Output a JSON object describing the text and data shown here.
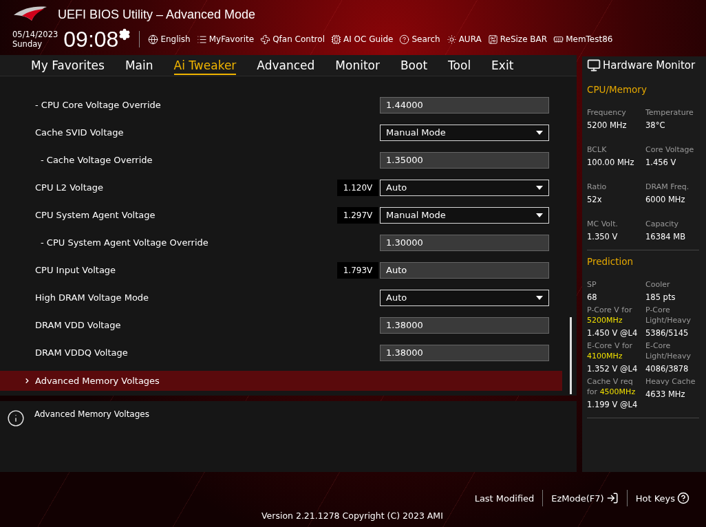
{
  "header": {
    "title": "UEFI BIOS Utility – Advanced Mode",
    "date": "05/14/2023",
    "day": "Sunday",
    "time": "09:08",
    "tools": [
      {
        "label": "English"
      },
      {
        "label": "MyFavorite"
      },
      {
        "label": "Qfan Control"
      },
      {
        "label": "AI OC Guide"
      },
      {
        "label": "Search"
      },
      {
        "label": "AURA"
      },
      {
        "label": "ReSize BAR"
      },
      {
        "label": "MemTest86"
      }
    ]
  },
  "tabs": [
    {
      "label": "My Favorites",
      "selected": false
    },
    {
      "label": "Main",
      "selected": false
    },
    {
      "label": "Ai Tweaker",
      "selected": true
    },
    {
      "label": "Advanced",
      "selected": false
    },
    {
      "label": "Monitor",
      "selected": false
    },
    {
      "label": "Boot",
      "selected": false
    },
    {
      "label": "Tool",
      "selected": false
    },
    {
      "label": "Exit",
      "selected": false
    }
  ],
  "settings": [
    {
      "label": "- CPU Core Voltage Override",
      "kind": "input",
      "value": "1.44000",
      "selected": false
    },
    {
      "label": "Cache SVID Voltage",
      "kind": "select",
      "value": "Manual Mode",
      "selected": false,
      "children": [
        {
          "label": "- Cache Voltage Override",
          "kind": "input",
          "value": "1.35000",
          "selected": false
        }
      ]
    },
    {
      "label": "CPU L2 Voltage",
      "kind": "select",
      "value": "Auto",
      "reading": "1.120V",
      "selected": false
    },
    {
      "label": "CPU System Agent Voltage",
      "kind": "select",
      "value": "Manual Mode",
      "reading": "1.297V",
      "selected": false,
      "children": [
        {
          "label": "- CPU System Agent Voltage Override",
          "kind": "input",
          "value": "1.30000",
          "selected": false
        }
      ]
    },
    {
      "label": "CPU Input Voltage",
      "kind": "input",
      "value": "Auto",
      "reading": "1.793V",
      "selected": false
    },
    {
      "label": "High DRAM Voltage Mode",
      "kind": "select",
      "value": "Auto",
      "selected": false
    },
    {
      "label": "DRAM VDD Voltage",
      "kind": "input",
      "value": "1.38000",
      "selected": false
    },
    {
      "label": "DRAM VDDQ Voltage",
      "kind": "input",
      "value": "1.38000",
      "selected": false
    },
    {
      "label": "Advanced Memory Voltages",
      "kind": "submenu",
      "selected": true
    }
  ],
  "help": {
    "text": "Advanced Memory Voltages"
  },
  "hardware_monitor": {
    "title": "Hardware Monitor",
    "sections": [
      {
        "title": "CPU/Memory",
        "items": [
          {
            "label": "Frequency",
            "value": "5200 MHz"
          },
          {
            "label": "Temperature",
            "value": "38°C"
          },
          {
            "label": "BCLK",
            "value": "100.00 MHz"
          },
          {
            "label": "Core Voltage",
            "value": "1.456 V"
          },
          {
            "label": "Ratio",
            "value": "52x"
          },
          {
            "label": "DRAM Freq.",
            "value": "6000 MHz"
          },
          {
            "label": "MC Volt.",
            "value": "1.350 V"
          },
          {
            "label": "Capacity",
            "value": "16384 MB"
          }
        ]
      },
      {
        "title": "Prediction",
        "items": [
          {
            "label": "SP",
            "value": "68"
          },
          {
            "label": "Cooler",
            "value": "185 pts"
          },
          {
            "label": "P-Core V for",
            "highlight": "5200MHz",
            "value": "1.450 V @L4"
          },
          {
            "label": "P-Core Light/Heavy",
            "value": "5386/5145"
          },
          {
            "label": "E-Core V for",
            "highlight": "4100MHz",
            "value": "1.352 V @L4"
          },
          {
            "label": "E-Core Light/Heavy",
            "value": "4086/3878"
          },
          {
            "label": "Cache V req for",
            "highlight": "4500MHz",
            "value": "1.199 V @L4"
          },
          {
            "label": "Heavy Cache",
            "value": "4633 MHz"
          }
        ]
      }
    ]
  },
  "footer": {
    "actions": [
      {
        "label": "Last Modified"
      },
      {
        "label": "EzMode(F7)"
      },
      {
        "label": "Hot Keys"
      }
    ],
    "version": "Version 2.21.1278 Copyright (C) 2023 AMI"
  }
}
